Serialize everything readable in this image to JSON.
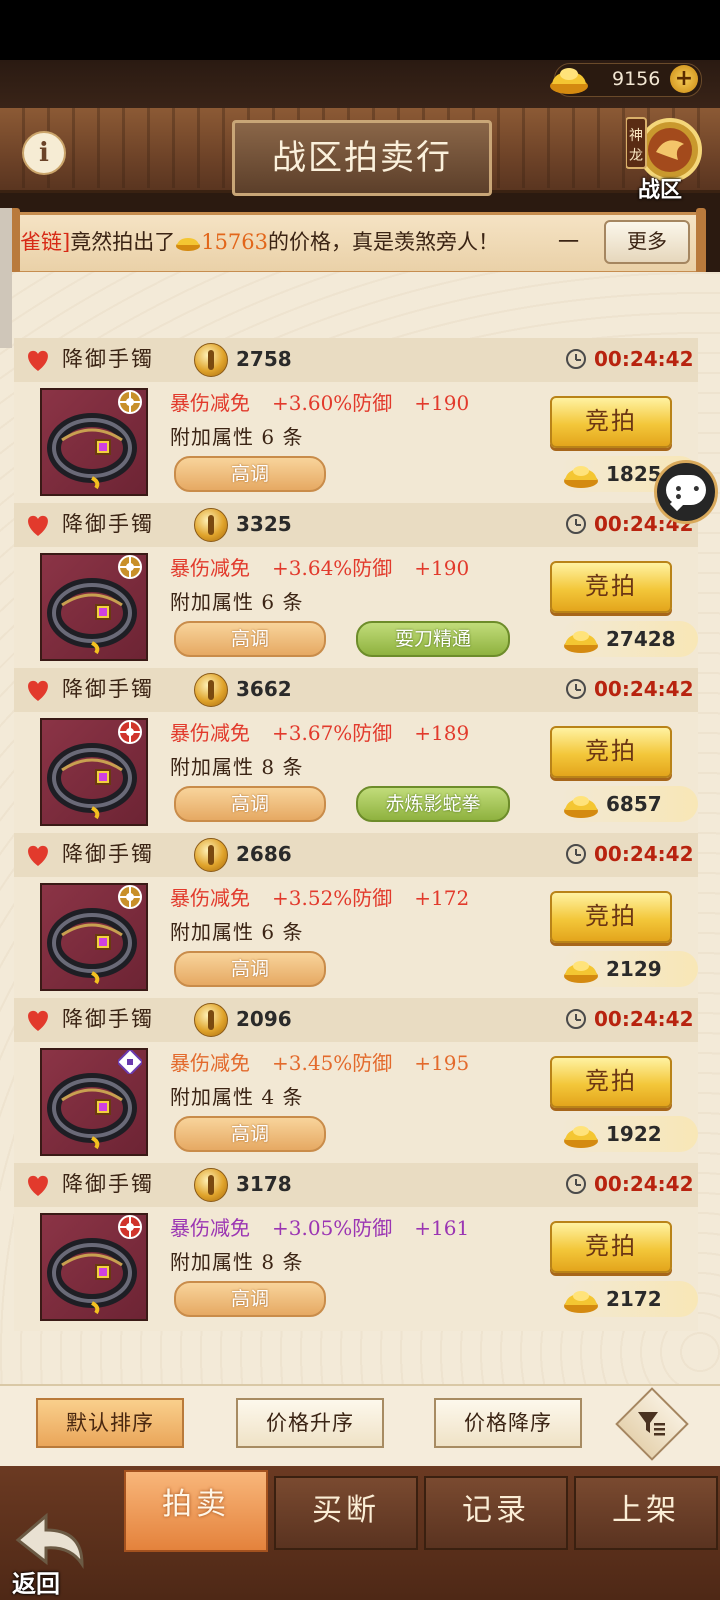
{
  "currency": {
    "gold": "9156",
    "plus_icon": "plus-icon"
  },
  "header": {
    "title": "战区拍卖行",
    "info_icon": "i",
    "zone_badge_text": "神龙",
    "zone_label": "战区"
  },
  "ticker": {
    "prefix": "雀链]",
    "text_before": "竟然拍出了",
    "price": "15763",
    "text_after": "的价格，真是羡煞旁人！",
    "tail": "一",
    "more_button": "更多"
  },
  "colors": {
    "accent": "#f3c73a",
    "timer": "#b8230f",
    "stat_red": "#e23a2c",
    "stat_orange": "#e36a2c",
    "stat_purple": "#9b35b3"
  },
  "items": [
    {
      "name": "降御手镯",
      "start_price": "2758",
      "timer": "00:24:42",
      "stats": [
        "暴伤减免",
        "+3.60%防御",
        "+190"
      ],
      "stat_color": "red",
      "extra": "附加属性 6 条",
      "tone_tag": "高调",
      "skill_tag": null,
      "bid_label": "竞拍",
      "buyout": "1825",
      "quality": "flower"
    },
    {
      "name": "降御手镯",
      "start_price": "3325",
      "timer": "00:24:42",
      "stats": [
        "暴伤减免",
        "+3.64%防御",
        "+190"
      ],
      "stat_color": "red",
      "extra": "附加属性 6 条",
      "tone_tag": "高调",
      "skill_tag": "耍刀精通",
      "bid_label": "竞拍",
      "buyout": "27428",
      "quality": "flower"
    },
    {
      "name": "降御手镯",
      "start_price": "3662",
      "timer": "00:24:42",
      "stats": [
        "暴伤减免",
        "+3.67%防御",
        "+189"
      ],
      "stat_color": "red",
      "extra": "附加属性 8 条",
      "tone_tag": "高调",
      "skill_tag": "赤炼影蛇拳",
      "bid_label": "竞拍",
      "buyout": "6857",
      "quality": "red-flower"
    },
    {
      "name": "降御手镯",
      "start_price": "2686",
      "timer": "00:24:42",
      "stats": [
        "暴伤减免",
        "+3.52%防御",
        "+172"
      ],
      "stat_color": "red",
      "extra": "附加属性 6 条",
      "tone_tag": "高调",
      "skill_tag": null,
      "bid_label": "竞拍",
      "buyout": "2129",
      "quality": "flower"
    },
    {
      "name": "降御手镯",
      "start_price": "2096",
      "timer": "00:24:42",
      "stats": [
        "暴伤减免",
        "+3.45%防御",
        "+195"
      ],
      "stat_color": "orange",
      "extra": "附加属性 4 条",
      "tone_tag": "高调",
      "skill_tag": null,
      "bid_label": "竞拍",
      "buyout": "1922",
      "quality": "purple"
    },
    {
      "name": "降御手镯",
      "start_price": "3178",
      "timer": "00:24:42",
      "stats": [
        "暴伤减免",
        "+3.05%防御",
        "+161"
      ],
      "stat_color": "purple",
      "extra": "附加属性 8 条",
      "tone_tag": "高调",
      "skill_tag": null,
      "bid_label": "竞拍",
      "buyout": "2172",
      "quality": "red-flower"
    }
  ],
  "sort": {
    "default": "默认排序",
    "price_asc": "价格升序",
    "price_desc": "价格降序",
    "active": "default"
  },
  "tabs": [
    {
      "label": "拍卖",
      "active": true
    },
    {
      "label": "买断",
      "active": false
    },
    {
      "label": "记录",
      "active": false
    },
    {
      "label": "上架",
      "active": false
    }
  ],
  "back_label": "返回"
}
